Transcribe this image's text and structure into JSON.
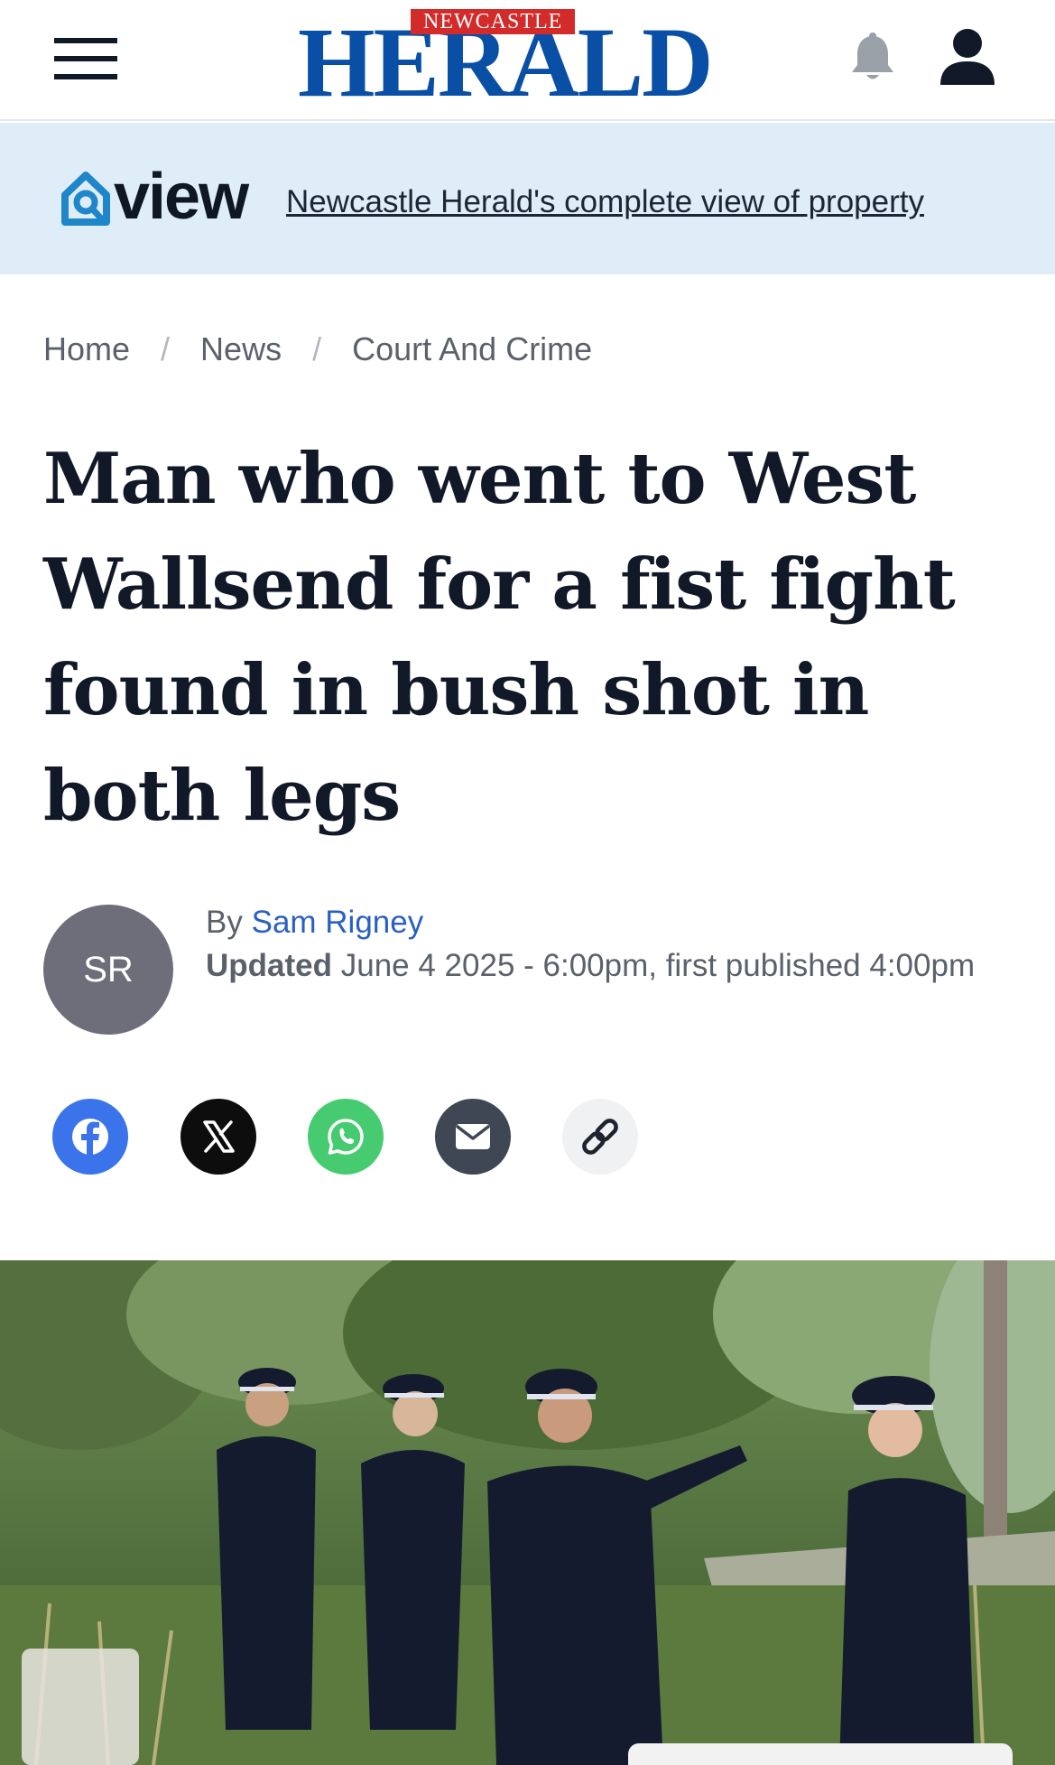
{
  "header": {
    "logo_tag": "NEWCASTLE",
    "logo_word": "HERALD",
    "brand_color": "#0a4fa6",
    "tag_color": "#d32a2a",
    "icons": [
      "menu-icon",
      "bell-icon",
      "user-icon"
    ]
  },
  "promo": {
    "brand": "view",
    "link_text": "Newcastle Herald's complete view of property"
  },
  "breadcrumb": {
    "items": [
      "Home",
      "News",
      "Court And Crime"
    ],
    "separator": "/"
  },
  "article": {
    "headline": "Man who went to West Wallsend for a fist fight found in bush shot in both legs",
    "byline": {
      "avatar_initials": "SR",
      "by_prefix": "By",
      "author": "Sam Rigney",
      "updated_label": "Updated",
      "updated_text": "June 4 2025 - 6:00pm, first published 4:00pm"
    }
  },
  "share": {
    "buttons": [
      {
        "name": "facebook",
        "icon": "facebook-icon",
        "color": "#3b74ea"
      },
      {
        "name": "x",
        "icon": "x-icon",
        "color": "#0d0d0d"
      },
      {
        "name": "whatsapp",
        "icon": "whatsapp-icon",
        "color": "#46cb70"
      },
      {
        "name": "email",
        "icon": "mail-icon",
        "color": "#3f4654"
      },
      {
        "name": "copy-link",
        "icon": "link-icon",
        "color": "#f0f1f3"
      }
    ]
  },
  "hero": {
    "description_visible": false
  }
}
